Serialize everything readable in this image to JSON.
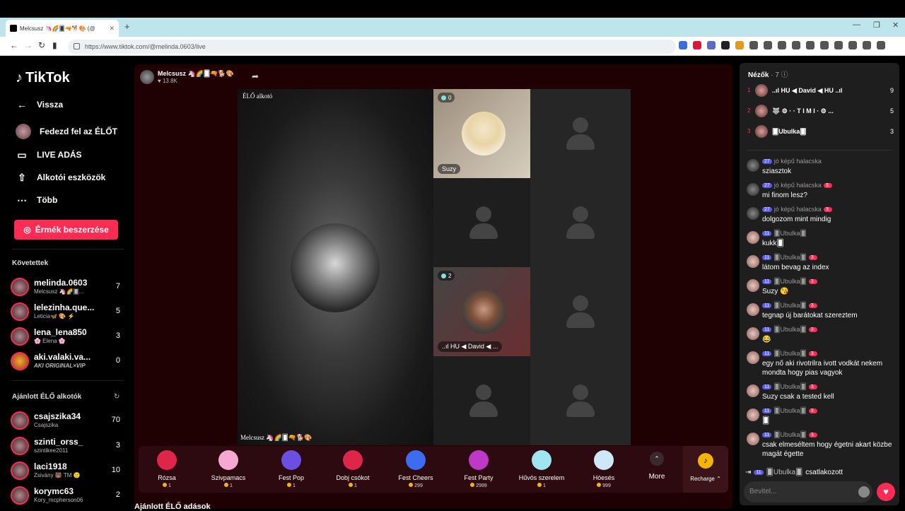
{
  "browser": {
    "tab_title": "Melcsusz 🦄🌈🂠🔫🐕🎨 (@",
    "url": "https://www.tiktok.com/@melinda.0603/live"
  },
  "sidebar": {
    "logo": "TikTok",
    "nav": [
      {
        "label": "Vissza",
        "icon": "back-arrow-icon"
      },
      {
        "label": "Fedezd fel az ÉLŐT",
        "icon": "avatar"
      },
      {
        "label": "LIVE ADÁS",
        "icon": "video-camera-icon"
      },
      {
        "label": "Alkotói eszközök",
        "icon": "upload-icon"
      },
      {
        "label": "Több",
        "icon": "more-icon"
      }
    ],
    "coins_button": "Érmék beszerzése",
    "following_title": "Követettek",
    "following": [
      {
        "name": "melinda.0603",
        "sub": "Melcsusz 🦄🌈🂠...",
        "count": "7"
      },
      {
        "name": "lelezinha.que...",
        "sub": "Leticia🦋 🎨 ⚡",
        "count": "5"
      },
      {
        "name": "lena_lena850",
        "sub": "🌸 Elena 🌸",
        "count": "3"
      },
      {
        "name": "aki.valaki.va...",
        "sub": "AKI ORIGINAL×VIP",
        "count": "0"
      }
    ],
    "recommended_title": "Ajánlott ÉLŐ alkotók",
    "recommended": [
      {
        "name": "csajszika34",
        "sub": "Csajszika",
        "count": "70"
      },
      {
        "name": "szinti_orss_",
        "sub": "szintikee2011",
        "count": "3"
      },
      {
        "name": "laci1918",
        "sub": "Zsivány 🐻 TM 🙂",
        "count": "10"
      },
      {
        "name": "korymc63",
        "sub": "Kory_mcpherson06",
        "count": "2"
      }
    ]
  },
  "stream": {
    "host_name": "Melcsusz 🦄🌈🂠🔫🐕🎨",
    "host_likes": "♥ 13.8K",
    "live_creator_label": "ÉLŐ alkotó",
    "main_caption": "Melcsusz 🦄🌈🂠🔫🐕🎨",
    "guests": [
      {
        "name": "Suzy",
        "count": "0"
      },
      {
        "name": "..ıl HU ◀ David ◀ ...",
        "count": "2"
      }
    ],
    "recommend_heading": "Ajánlott ÉLŐ adások"
  },
  "gifts": [
    {
      "name": "Rózsa",
      "price": "1",
      "color": "#e0254a"
    },
    {
      "name": "Szivpamacs",
      "price": "1",
      "color": "#f5a9d0"
    },
    {
      "name": "Fest Pop",
      "price": "1",
      "color": "#6a4fe0"
    },
    {
      "name": "Dobj csókot",
      "price": "1",
      "color": "#e0254a"
    },
    {
      "name": "Fest Cheers",
      "price": "299",
      "color": "#3c6cf0"
    },
    {
      "name": "Fest Party",
      "price": "2999",
      "color": "#c038c8"
    },
    {
      "name": "Hűvös szerelem",
      "price": "1",
      "color": "#9fe6f0"
    },
    {
      "name": "Hóesés",
      "price": "999",
      "color": "#cfe8f8"
    }
  ],
  "gift_more": "More",
  "recharge": "Recharge ⌃",
  "chat": {
    "viewers_title": "Nézők",
    "viewers_count": "· 7 ⓘ",
    "viewers": [
      {
        "rank": "1",
        "name": "..ıl HU ◀ David ◀ HU ..ıl",
        "count": "9"
      },
      {
        "rank": "2",
        "name": "🐺 ⚙ · · T I M I · ⚙ ...",
        "count": "5"
      },
      {
        "rank": "3",
        "name": "🂠Ubulka🂠",
        "count": "3"
      }
    ],
    "messages": [
      {
        "user": "jó képű halacska",
        "level": "27",
        "fan": "",
        "text": "sziasztok"
      },
      {
        "user": "jó képű halacska",
        "level": "27",
        "fan": "3.",
        "text": "mi finom lesz?"
      },
      {
        "user": "jó képű halacska",
        "level": "27",
        "fan": "3.",
        "text": "dolgozom mint mindig"
      },
      {
        "user": "🂠Ubulka🂠",
        "level": "11",
        "fan": "",
        "text": "kukk🂠"
      },
      {
        "user": "🂠Ubulka🂠",
        "level": "11",
        "fan": "3.",
        "text": "látom bevag az index"
      },
      {
        "user": "🂠Ubulka🂠",
        "level": "11",
        "fan": "3.",
        "text": "Suzy 😘"
      },
      {
        "user": "🂠Ubulka🂠",
        "level": "11",
        "fan": "3.",
        "text": "tegnap új barátokat szereztem"
      },
      {
        "user": "🂠Ubulka🂠",
        "level": "11",
        "fan": "3.",
        "text": "😂"
      },
      {
        "user": "🂠Ubulka🂠",
        "level": "11",
        "fan": "3.",
        "text": "egy nő aki rivotrilra ivott vodkát nekem mondta hogy pias vagyok"
      },
      {
        "user": "🂠Ubulka🂠",
        "level": "11",
        "fan": "3.",
        "text": "Suzy csak a tested kell"
      },
      {
        "user": "🂠Ubulka🂠",
        "level": "11",
        "fan": "3.",
        "text": "🂠"
      },
      {
        "user": "🂠Ubulka🂠",
        "level": "11",
        "fan": "3.",
        "text": "csak elmeséltem hogy égetni akart közbe magát égette"
      }
    ],
    "joined_user": "🂠Ubulka🂠",
    "joined_text": "csatlakozott",
    "joined_level": "11",
    "input_placeholder": "Bevitel..."
  }
}
